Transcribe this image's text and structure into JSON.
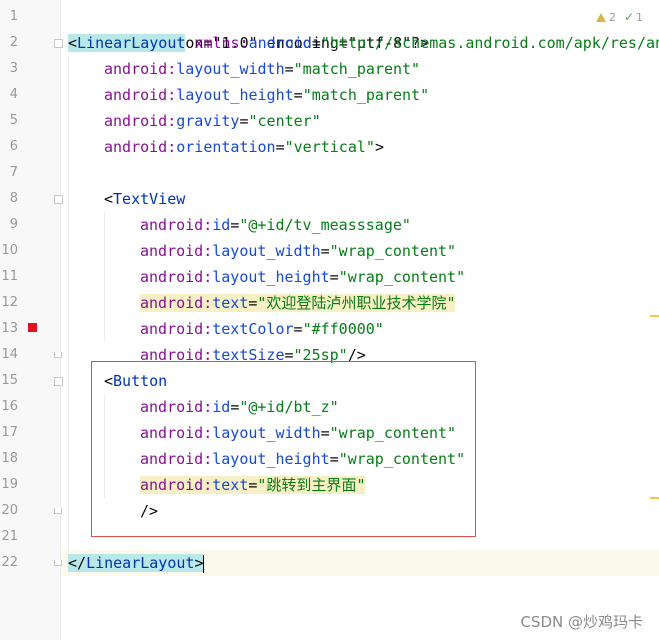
{
  "editor": {
    "line_numbers": [
      "1",
      "2",
      "3",
      "4",
      "5",
      "6",
      "7",
      "8",
      "9",
      "10",
      "11",
      "12",
      "13",
      "14",
      "15",
      "16",
      "17",
      "18",
      "19",
      "20",
      "21",
      "22"
    ],
    "lines": {
      "l1_proc": "<?xml version=\"1.0\" encoding=\"utf-8\"?>",
      "l2_open": "<",
      "l2_tag": "LinearLayout",
      "l2_ns": " xmlns:",
      "l2_attr": "android",
      "l2_eq": "=",
      "l2_val": "\"http://schemas.android.com/apk/res/an",
      "l3_ns": "android:",
      "l3_attr": "layout_width",
      "l3_eq": "=",
      "l3_val": "\"match_parent\"",
      "l4_ns": "android:",
      "l4_attr": "layout_height",
      "l4_eq": "=",
      "l4_val": "\"match_parent\"",
      "l5_ns": "android:",
      "l5_attr": "gravity",
      "l5_eq": "=",
      "l5_val": "\"center\"",
      "l6_ns": "android:",
      "l6_attr": "orientation",
      "l6_eq": "=",
      "l6_val": "\"vertical\"",
      "l6_close": ">",
      "l8_open": "<",
      "l8_tag": "TextView",
      "l9_ns": "android:",
      "l9_attr": "id",
      "l9_eq": "=",
      "l9_val": "\"@+id/tv_measssage\"",
      "l10_ns": "android:",
      "l10_attr": "layout_width",
      "l10_eq": "=",
      "l10_val": "\"wrap_content\"",
      "l11_ns": "android:",
      "l11_attr": "layout_height",
      "l11_eq": "=",
      "l11_val": "\"wrap_content\"",
      "l12_ns": "android:",
      "l12_attr": "text",
      "l12_eq": "=",
      "l12_val": "\"欢迎登陆泸州职业技术学院\"",
      "l13_ns": "android:",
      "l13_attr": "textColor",
      "l13_eq": "=",
      "l13_val": "\"#ff0000\"",
      "l14_ns": "android:",
      "l14_attr": "textSize",
      "l14_eq": "=",
      "l14_val": "\"25sp\"",
      "l14_close": "/>",
      "l15_open": "<",
      "l15_tag": "Button",
      "l16_ns": "android:",
      "l16_attr": "id",
      "l16_eq": "=",
      "l16_val": "\"@+id/bt_z\"",
      "l17_ns": "android:",
      "l17_attr": "layout_width",
      "l17_eq": "=",
      "l17_val": "\"wrap_content\"",
      "l18_ns": "android:",
      "l18_attr": "layout_height",
      "l18_eq": "=",
      "l18_val": "\"wrap_content\"",
      "l19_ns": "android:",
      "l19_attr": "text",
      "l19_eq": "=",
      "l19_val": "\"跳转到主界面\"",
      "l20_close": "/>",
      "l22_open": "</",
      "l22_tag": "LinearLayout",
      "l22_close": ">"
    }
  },
  "inspection": {
    "warnings_count": "2",
    "weak_warnings_count": "1",
    "warning_icon": "warning-triangle-icon",
    "weak_icon": "check-icon"
  },
  "watermark": "CSDN @炒鸡玛卡",
  "colors": {
    "tag": "#0033b3",
    "namespace": "#871094",
    "attribute": "#174ad4",
    "value": "#067d17",
    "highlight_box": "#e05050",
    "breakpoint": "#e81123"
  }
}
